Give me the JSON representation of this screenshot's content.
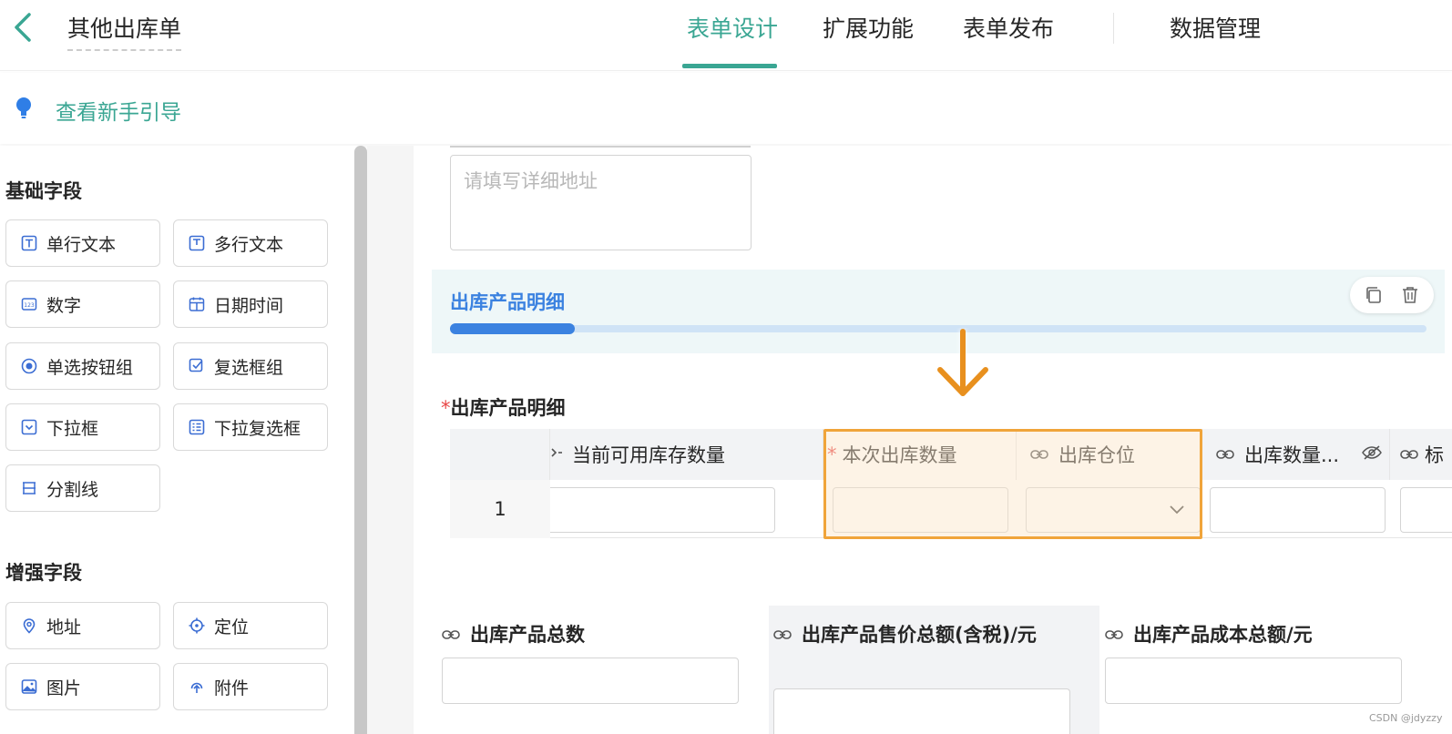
{
  "header": {
    "form_title": "其他出库单",
    "tabs": [
      {
        "label": "表单设计",
        "active": true
      },
      {
        "label": "扩展功能",
        "active": false
      },
      {
        "label": "表单发布",
        "active": false
      },
      {
        "label": "数据管理",
        "active": false
      }
    ]
  },
  "guide": {
    "label": "查看新手引导"
  },
  "sidebar": {
    "basic_title": "基础字段",
    "basic_fields": [
      {
        "label": "单行文本",
        "icon": "text-icon"
      },
      {
        "label": "多行文本",
        "icon": "multiline-text-icon"
      },
      {
        "label": "数字",
        "icon": "number-icon"
      },
      {
        "label": "日期时间",
        "icon": "calendar-icon"
      },
      {
        "label": "单选按钮组",
        "icon": "radio-icon"
      },
      {
        "label": "复选框组",
        "icon": "checkbox-icon"
      },
      {
        "label": "下拉框",
        "icon": "dropdown-icon"
      },
      {
        "label": "下拉复选框",
        "icon": "dropdown-checkbox-icon"
      },
      {
        "label": "分割线",
        "icon": "divider-icon"
      }
    ],
    "enhanced_title": "增强字段",
    "enhanced_fields": [
      {
        "label": "地址",
        "icon": "location-pin-icon"
      },
      {
        "label": "定位",
        "icon": "locate-icon"
      },
      {
        "label": "图片",
        "icon": "image-icon"
      },
      {
        "label": "附件",
        "icon": "attachment-icon"
      }
    ]
  },
  "canvas": {
    "address_placeholder": "请填写详细地址",
    "detail_bar_title": "出库产品明细",
    "subtable_label": "出库产品明细",
    "required_mark": "*",
    "columns": [
      {
        "label": "当前可用库存数量",
        "required": false
      },
      {
        "label": "本次出库数量",
        "required": true
      },
      {
        "label": "出库仓位",
        "required": false
      },
      {
        "label": "出库数量...",
        "required": false
      },
      {
        "label": "标",
        "required": false
      }
    ],
    "row_number": "1",
    "summary_fields": [
      {
        "label": "出库产品总数"
      },
      {
        "label": "出库产品售价总额(含税)/元"
      },
      {
        "label": "出库产品成本总额/元"
      }
    ]
  },
  "watermark": "CSDN @jdyzzy",
  "colors": {
    "accent": "#3aa693",
    "blue": "#3b82e0",
    "highlight": "#f0a43a",
    "required": "#e84646"
  }
}
